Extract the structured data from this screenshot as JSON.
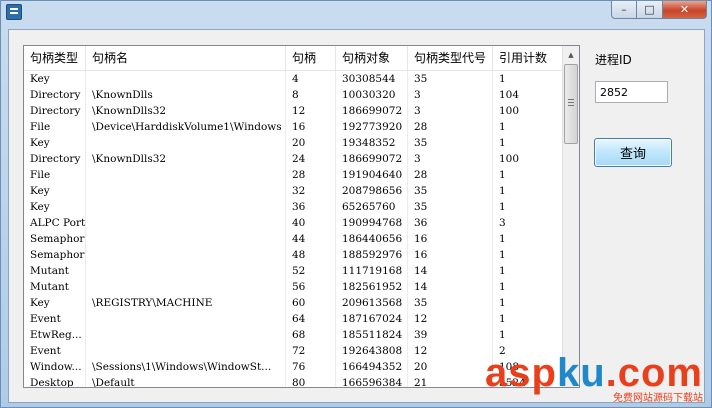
{
  "window": {
    "title": ""
  },
  "list": {
    "columns": [
      "句柄类型",
      "句柄名",
      "句柄",
      "句柄对象",
      "句柄类型代号",
      "引用计数"
    ],
    "rows": [
      [
        "Key",
        "",
        "4",
        "30308544",
        "35",
        "1"
      ],
      [
        "Directory",
        "\\KnownDlls",
        "8",
        "10030320",
        "3",
        "104"
      ],
      [
        "Directory",
        "\\KnownDlls32",
        "12",
        "186699072",
        "3",
        "100"
      ],
      [
        "File",
        "\\Device\\HarddiskVolume1\\Windows",
        "16",
        "192773920",
        "28",
        "1"
      ],
      [
        "Key",
        "",
        "20",
        "19348352",
        "35",
        "1"
      ],
      [
        "Directory",
        "\\KnownDlls32",
        "24",
        "186699072",
        "3",
        "100"
      ],
      [
        "File",
        "",
        "28",
        "191904640",
        "28",
        "1"
      ],
      [
        "Key",
        "",
        "32",
        "208798656",
        "35",
        "1"
      ],
      [
        "Key",
        "",
        "36",
        "65265760",
        "35",
        "1"
      ],
      [
        "ALPC Port",
        "",
        "40",
        "190994768",
        "36",
        "3"
      ],
      [
        "Semaphore",
        "",
        "44",
        "186440656",
        "16",
        "1"
      ],
      [
        "Semaphore",
        "",
        "48",
        "188592976",
        "16",
        "1"
      ],
      [
        "Mutant",
        "",
        "52",
        "111719168",
        "14",
        "1"
      ],
      [
        "Mutant",
        "",
        "56",
        "182561952",
        "14",
        "1"
      ],
      [
        "Key",
        "\\REGISTRY\\MACHINE",
        "60",
        "209613568",
        "35",
        "1"
      ],
      [
        "Event",
        "",
        "64",
        "187167024",
        "12",
        "1"
      ],
      [
        "EtwReg...",
        "",
        "68",
        "185511824",
        "39",
        "1"
      ],
      [
        "Event",
        "",
        "72",
        "192643808",
        "12",
        "2"
      ],
      [
        "Window...",
        "\\Sessions\\1\\Windows\\WindowSt...",
        "76",
        "166494352",
        "20",
        "108"
      ],
      [
        "Desktop",
        "\\Default",
        "80",
        "166596384",
        "21",
        "3524"
      ]
    ]
  },
  "panel": {
    "pid_label": "进程ID",
    "pid_value": "2852",
    "query_label": "查询"
  },
  "watermark": {
    "brand_part1": "asp",
    "brand_part2": "ku",
    "brand_part3": ".com",
    "subtitle": "免费网站源码下载站"
  },
  "icons": {
    "minimize": "minimize-icon",
    "maximize": "maximize-icon",
    "close": "close-icon",
    "scroll_up": "arrow-up-icon",
    "scroll_down": "arrow-down-icon"
  }
}
